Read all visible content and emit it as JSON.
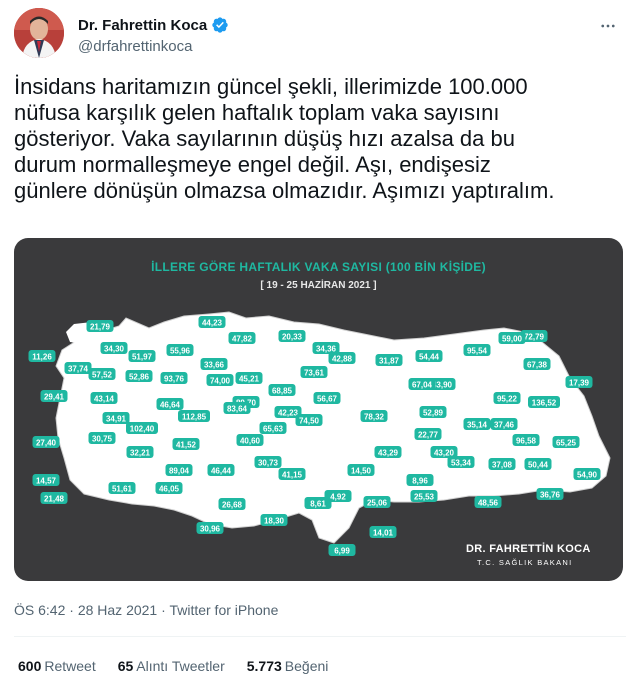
{
  "author": {
    "display_name": "Dr. Fahrettin Koca",
    "handle": "@drfahrettinkoca",
    "verified": true
  },
  "tweet": {
    "text_lines": [
      "İnsidans haritamızın güncel şekli, illerimizde 100.000",
      "nüfusa karşılık gelen haftalık toplam vaka sayısını",
      "gösteriyor. Vaka sayılarının düşüş hızı azalsa da bu",
      "durum normalleşmeye engel değil. Aşı, endişesiz",
      "günlere dönüşün olmazsa olmazıdır. Aşımızı yaptıralım."
    ]
  },
  "media": {
    "title": "İLLERE GÖRE HAFTALIK VAKA SAYISI (100 BİN KİŞİDE)",
    "dates": "[ 19 - 25 HAZİRAN 2021 ]",
    "signature_name": "DR. FAHRETTİN KOCA",
    "signature_title": "T.C. SAĞLIK BAKANI",
    "accent_color": "#1fb8a1",
    "map_fill": "#ffffff",
    "background": "#3a3a3c",
    "labels": [
      "21,79",
      "11,26",
      "34,30",
      "51,97",
      "55,96",
      "44,23",
      "47,82",
      "20,33",
      "34,36",
      "72,79",
      "37,74",
      "57,52",
      "33,66",
      "52,86",
      "93,76",
      "42,88",
      "95,54",
      "59,00",
      "29,41",
      "43,14",
      "74,00",
      "45,21",
      "31,87",
      "54,44",
      "67,38",
      "17,39",
      "46,64",
      "89,70",
      "68,85",
      "73,61",
      "43,90",
      "34,91",
      "102,40",
      "112,85",
      "83,64",
      "42,23",
      "56,67",
      "67,04",
      "95,22",
      "136,52",
      "27,40",
      "30,75",
      "41,52",
      "65,63",
      "74,50",
      "78,32",
      "52,89",
      "35,14",
      "37,46",
      "32,21",
      "40,60",
      "22,77",
      "96,58",
      "65,25",
      "89,04",
      "30,73",
      "41,15",
      "43,29",
      "43,20",
      "14,57",
      "46,44",
      "14,50",
      "53,34",
      "37,08",
      "50,44",
      "54,90",
      "51,61",
      "46,05",
      "8,96",
      "36,76",
      "21,48",
      "26,68",
      "8,61",
      "4,92",
      "25,06",
      "25,53",
      "48,56",
      "30,96",
      "18,30",
      "14,01",
      "6,99"
    ]
  },
  "meta": {
    "time": "ÖS 6:42",
    "date": "28 Haz 2021",
    "separator": "·",
    "source": "Twitter for iPhone"
  },
  "stats": {
    "retweets_count": "600",
    "retweets_label": "Retweet",
    "quotes_count": "65",
    "quotes_label": "Alıntı Tweetler",
    "likes_count": "5.773",
    "likes_label": "Beğeni"
  }
}
